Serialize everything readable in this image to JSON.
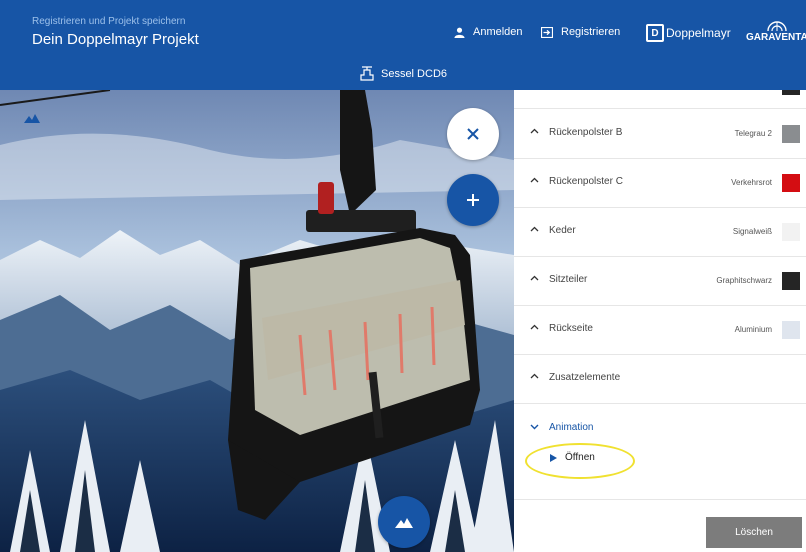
{
  "header": {
    "subtitle": "Registrieren und Projekt speichern",
    "title": "Dein Doppelmayr Projekt",
    "login_label": "Anmelden",
    "register_label": "Registrieren",
    "brand_primary": "Doppelmayr",
    "brand_secondary": "GARAVENTA",
    "model_label": "Sessel DCD6"
  },
  "colors": {
    "header_bg": "#1755a6",
    "accent": "#1755a6",
    "delete_bg": "#7c7c7c",
    "highlight": "#f0e130"
  },
  "scene": {
    "buttons": [
      {
        "name": "close",
        "icon": "close-icon"
      },
      {
        "name": "add",
        "icon": "plus-icon"
      },
      {
        "name": "view",
        "icon": "mountain-icon"
      }
    ]
  },
  "panel": {
    "items": [
      {
        "label": "Rückenpolster B",
        "value": "Telegrau 2",
        "color": "#8a8d90",
        "expanded": false
      },
      {
        "label": "Rückenpolster C",
        "value": "Verkehrsrot",
        "color": "#d40d12",
        "expanded": false
      },
      {
        "label": "Keder",
        "value": "Signalweiß",
        "color": "#f2f2f2",
        "expanded": false
      },
      {
        "label": "Sitzteiler",
        "value": "Graphitschwarz",
        "color": "#252525",
        "expanded": false
      },
      {
        "label": "Rückseite",
        "value": "Aluminium",
        "color": "#dfe5ee",
        "expanded": false
      },
      {
        "label": "Zusatzelemente",
        "value": "",
        "color": "",
        "expanded": false
      },
      {
        "label": "Animation",
        "value": "",
        "color": "",
        "expanded": true
      }
    ],
    "open_label": "Öffnen",
    "delete_label": "Löschen"
  }
}
